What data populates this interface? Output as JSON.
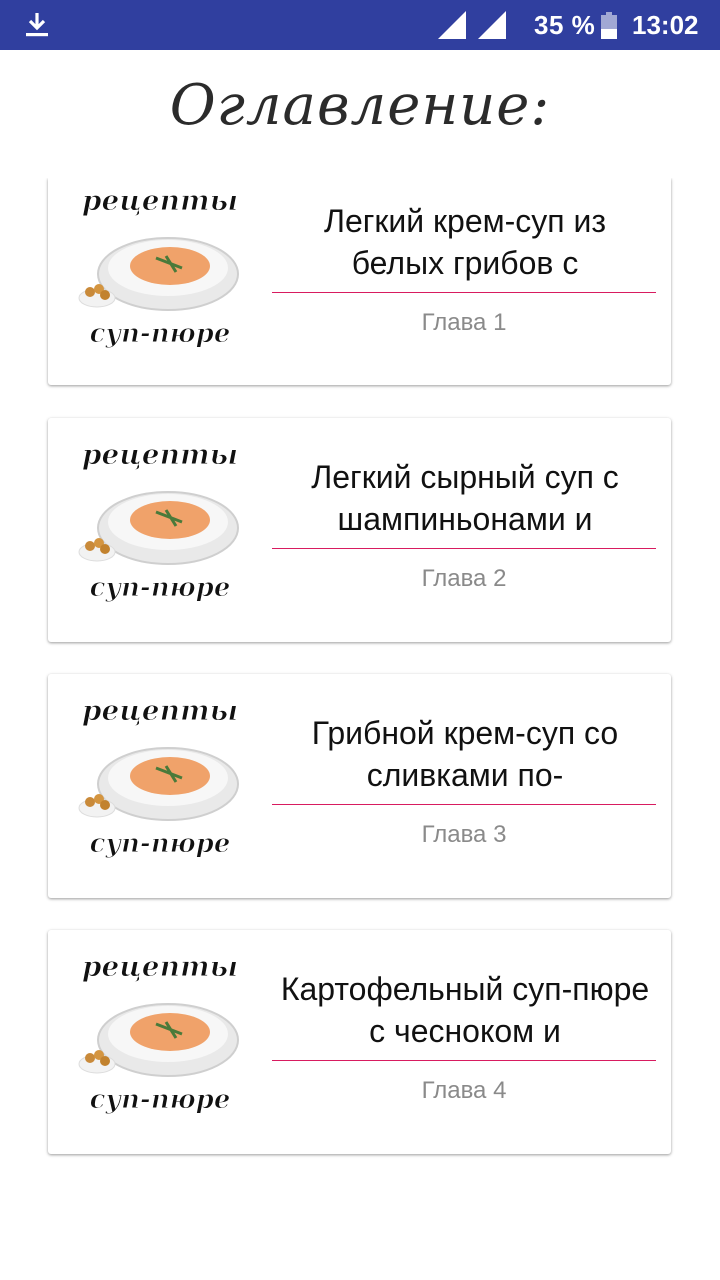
{
  "status_bar": {
    "battery": "35 %",
    "time": "13:02",
    "icons": [
      "download-icon",
      "signal-icon",
      "signal-icon",
      "battery-icon"
    ],
    "color": "#303f9f"
  },
  "header": {
    "title": "Оглавление:"
  },
  "thumbnail": {
    "top_text": "рецепты",
    "bottom_text": "суп-пюре"
  },
  "colors": {
    "accent": "#d81b60",
    "chapter_text": "#8a8a8a"
  },
  "chapters": [
    {
      "title": "Легкий крем-суп из белых грибов с",
      "label": "Глава 1"
    },
    {
      "title": "Легкий сырный суп с шампиньонами и",
      "label": "Глава 2"
    },
    {
      "title": "Грибной крем-суп со сливками по-",
      "label": "Глава 3"
    },
    {
      "title": "Картофельный суп-пюре с чесноком и",
      "label": "Глава 4"
    }
  ]
}
